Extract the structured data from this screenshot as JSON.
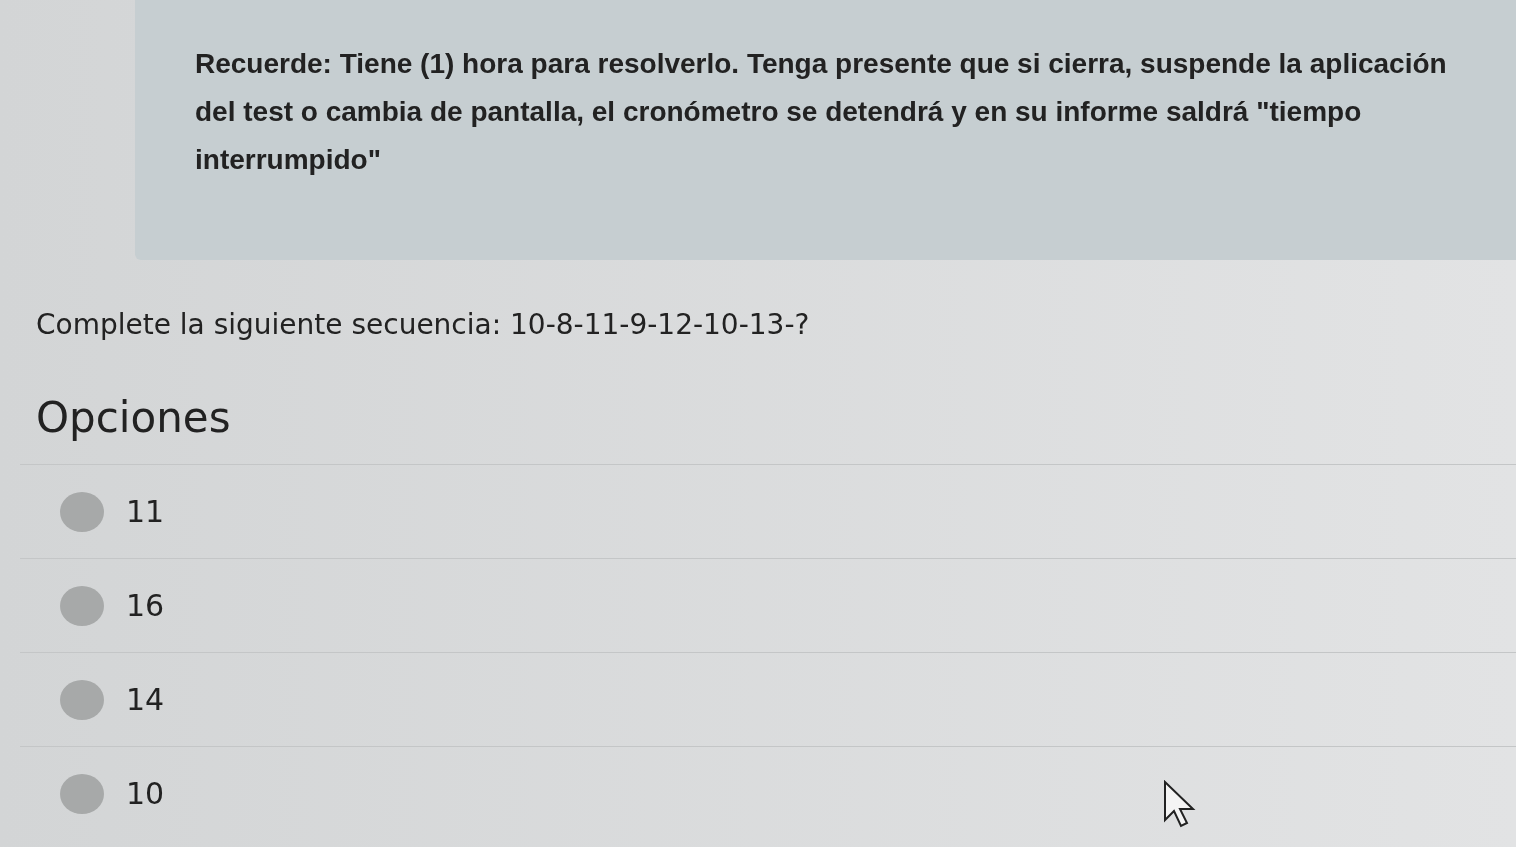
{
  "notice": {
    "text": "Recuerde: Tiene (1) hora para resolverlo. Tenga presente que si cierra, suspende la aplicación del test o cambia de pantalla, el cronómetro se detendrá y en su informe saldrá \"tiempo interrumpido\""
  },
  "question": {
    "text": "Complete la siguiente secuencia: 10-8-11-9-12-10-13-?"
  },
  "options_heading": "Opciones",
  "options": [
    {
      "label": "11",
      "selected": false
    },
    {
      "label": "16",
      "selected": false
    },
    {
      "label": "14",
      "selected": false
    },
    {
      "label": "10",
      "selected": false
    }
  ]
}
